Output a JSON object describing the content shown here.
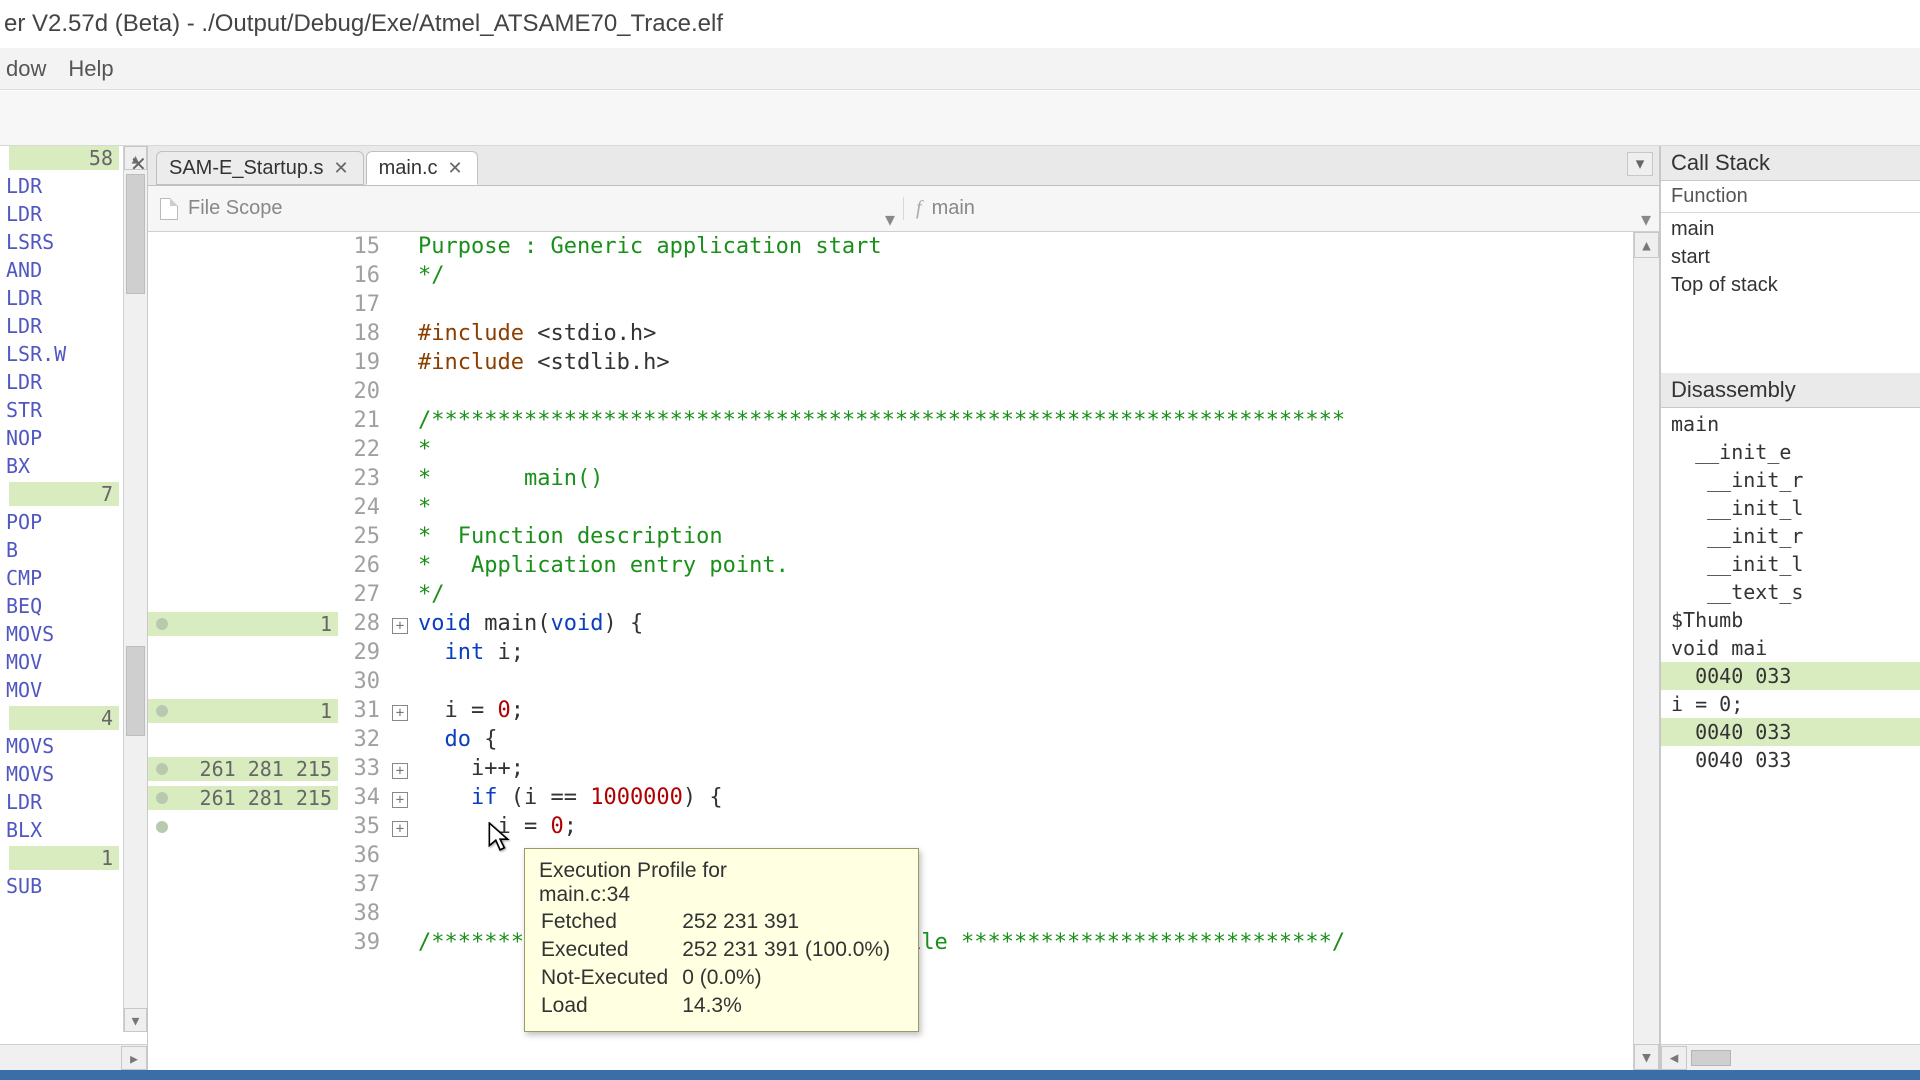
{
  "title": "er V2.57d (Beta) - ./Output/Debug/Exe/Atmel_ATSAME70_Trace.elf",
  "menus": {
    "window": "dow",
    "help": "Help"
  },
  "left": {
    "count_top": "58",
    "mnemonics_top": [
      "LDR",
      "LDR",
      "LSRS",
      "AND",
      "LDR",
      "LDR",
      "LSR.W",
      "LDR",
      "STR",
      "NOP",
      "BX"
    ],
    "count_mid1": "7",
    "mnemonics_mid1": [
      "POP",
      "B",
      "CMP",
      "BEQ",
      "MOVS",
      "MOV",
      "MOV"
    ],
    "count_mid2": "4",
    "mnemonics_mid2": [
      "MOVS",
      "MOVS",
      "LDR",
      "BLX"
    ],
    "count_bot": "1",
    "mnemonics_bot": [
      "SUB"
    ]
  },
  "tabs": [
    {
      "label": "SAM-E_Startup.s",
      "active": false
    },
    {
      "label": "main.c",
      "active": true
    }
  ],
  "scope": {
    "left_label": "File Scope",
    "right_label": "main",
    "right_glyph": "f"
  },
  "lines": [
    {
      "n": 15,
      "cov": "",
      "fold": "",
      "html": "<span class='c-comment'>Purpose : Generic application start</span>"
    },
    {
      "n": 16,
      "cov": "",
      "fold": "",
      "html": "<span class='c-comment'>*/</span>"
    },
    {
      "n": 17,
      "cov": "",
      "fold": "",
      "html": ""
    },
    {
      "n": 18,
      "cov": "",
      "fold": "",
      "html": "<span class='c-pre'>#include</span> &lt;stdio.h&gt;"
    },
    {
      "n": 19,
      "cov": "",
      "fold": "",
      "html": "<span class='c-pre'>#include</span> &lt;stdlib.h&gt;"
    },
    {
      "n": 20,
      "cov": "",
      "fold": "",
      "html": ""
    },
    {
      "n": 21,
      "cov": "",
      "fold": "",
      "html": "<span class='c-comment'>/*********************************************************************</span>"
    },
    {
      "n": 22,
      "cov": "",
      "fold": "",
      "html": "<span class='c-comment'>*</span>"
    },
    {
      "n": 23,
      "cov": "",
      "fold": "",
      "html": "<span class='c-comment'>*       main()</span>"
    },
    {
      "n": 24,
      "cov": "",
      "fold": "",
      "html": "<span class='c-comment'>*</span>"
    },
    {
      "n": 25,
      "cov": "",
      "fold": "",
      "html": "<span class='c-comment'>*  Function description</span>"
    },
    {
      "n": 26,
      "cov": "",
      "fold": "",
      "html": "<span class='c-comment'>*   Application entry point.</span>"
    },
    {
      "n": 27,
      "cov": "",
      "fold": "",
      "html": "<span class='c-comment'>*/</span>"
    },
    {
      "n": 28,
      "cov": "1",
      "hit": true,
      "fold": "+",
      "html": "<span class='c-keyword'>void</span> main(<span class='c-keyword'>void</span>) {"
    },
    {
      "n": 29,
      "cov": "",
      "fold": "",
      "html": "  <span class='c-keyword'>int</span> i;"
    },
    {
      "n": 30,
      "cov": "",
      "fold": "",
      "html": ""
    },
    {
      "n": 31,
      "cov": "1",
      "hit": true,
      "fold": "+",
      "html": "  i = <span class='c-number'>0</span>;"
    },
    {
      "n": 32,
      "cov": "",
      "fold": "",
      "html": "  <span class='c-keyword'>do</span> {"
    },
    {
      "n": 33,
      "cov": "261 281 215",
      "hit": true,
      "fold": "+",
      "html": "    i++;"
    },
    {
      "n": 34,
      "cov": "261 281 215",
      "hit": true,
      "fold": "+",
      "html": "    <span class='c-keyword'>if</span> (i == <span class='c-number'>1000000</span>) {"
    },
    {
      "n": 35,
      "cov": "",
      "hit": true,
      "fold": "+",
      "html": "      i = <span class='c-number'>0</span>;"
    },
    {
      "n": 36,
      "cov": "",
      "fold": "",
      "html": ""
    },
    {
      "n": 37,
      "cov": "",
      "fold": "",
      "html": ""
    },
    {
      "n": 38,
      "cov": "",
      "fold": "",
      "html": ""
    },
    {
      "n": 39,
      "cov": "",
      "fold": "",
      "html": "<span class='c-comment'>/*************************** End of file ****************************/</span>"
    }
  ],
  "tooltip": {
    "title1": "Execution Profile for",
    "title2": "main.c:34",
    "rows": [
      [
        "Fetched",
        "252 231 391"
      ],
      [
        "Executed",
        "252 231 391 (100.0%)"
      ],
      [
        "Not-Executed",
        "0 (0.0%)"
      ],
      [
        "Load",
        "14.3%"
      ]
    ]
  },
  "callstack": {
    "title": "Call Stack",
    "header": "Function",
    "rows": [
      "main",
      "start",
      "Top of stack"
    ]
  },
  "disasm": {
    "title": "Disassembly",
    "rows": [
      {
        "t": "main",
        "hl": false
      },
      {
        "t": "  __init_e",
        "hl": false
      },
      {
        "t": "   __init_r",
        "hl": false
      },
      {
        "t": "   __init_l",
        "hl": false
      },
      {
        "t": "   __init_r",
        "hl": false
      },
      {
        "t": "   __init_l",
        "hl": false
      },
      {
        "t": "   __text_s",
        "hl": false
      },
      {
        "t": "$Thumb",
        "hl": false
      },
      {
        "t": "void mai",
        "hl": false
      },
      {
        "t": "  0040 033",
        "hl": true
      },
      {
        "t": "i = 0;",
        "hl": false
      },
      {
        "t": "  0040 033",
        "hl": true
      },
      {
        "t": "  0040 033",
        "hl": false
      }
    ]
  }
}
